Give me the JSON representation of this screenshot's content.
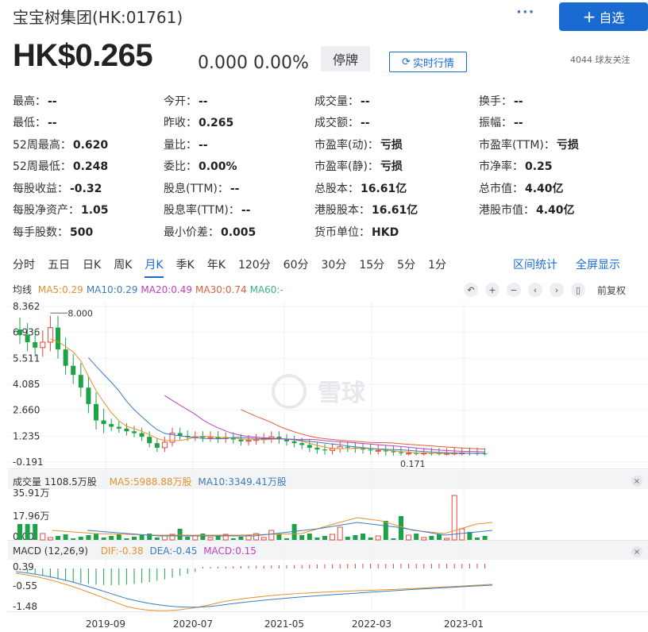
{
  "header": {
    "title": "宝宝树集团(HK:01761)",
    "more_label": "···",
    "add_label": "自选"
  },
  "price": {
    "value": "HK$0.265",
    "change": "0.000 0.00%",
    "status": "停牌",
    "realtime_label": "实时行情",
    "followers": "4044  球友关注"
  },
  "quote": [
    [
      [
        "最高：",
        "--"
      ],
      [
        "今开：",
        "--"
      ],
      [
        "成交量：",
        "--"
      ],
      [
        "换手：",
        "--"
      ]
    ],
    [
      [
        "最低：",
        "--"
      ],
      [
        "昨收：",
        "0.265"
      ],
      [
        "成交额：",
        "--"
      ],
      [
        "振幅：",
        "--"
      ]
    ],
    [
      [
        "52周最高：",
        "0.620"
      ],
      [
        "量比：",
        "--"
      ],
      [
        "市盈率(动)：",
        "亏损"
      ],
      [
        "市盈率(TTM)：",
        "亏损"
      ]
    ],
    [
      [
        "52周最低：",
        "0.248"
      ],
      [
        "委比：",
        "0.00%"
      ],
      [
        "市盈率(静)：",
        "亏损"
      ],
      [
        "市净率：",
        "0.25"
      ]
    ],
    [
      [
        "每股收益：",
        "-0.32"
      ],
      [
        "股息(TTM)：",
        "--"
      ],
      [
        "总股本：",
        "16.61亿"
      ],
      [
        "总市值：",
        "4.40亿"
      ]
    ],
    [
      [
        "每股净资产：",
        "1.05"
      ],
      [
        "股息率(TTM)：",
        "--"
      ],
      [
        "港股股本：",
        "16.61亿"
      ],
      [
        "港股市值：",
        "4.40亿"
      ]
    ],
    [
      [
        "每手股数：",
        "500"
      ],
      [
        "最小价差：",
        "0.005"
      ],
      [
        "货币单位：",
        "HKD"
      ],
      [
        "",
        ""
      ]
    ]
  ],
  "tabs": [
    "分时",
    "五日",
    "日K",
    "周K",
    "月K",
    "季K",
    "年K",
    "120分",
    "60分",
    "30分",
    "15分",
    "5分",
    "1分"
  ],
  "active_tab": "月K",
  "tabs_right": [
    "区间统计",
    "全屏显示"
  ],
  "kline": {
    "label": "均线",
    "ma": [
      {
        "text": "MA5:0.29",
        "color": "#e8902a"
      },
      {
        "text": "MA10:0.29",
        "color": "#3a7bc0"
      },
      {
        "text": "MA20:0.49",
        "color": "#c23fc0"
      },
      {
        "text": "MA30:0.74",
        "color": "#e0603a"
      },
      {
        "text": "MA60:-",
        "color": "#3cb47c"
      }
    ],
    "adjust_label": "前复权",
    "max_label": "8.000",
    "min_label": "0.171",
    "watermark": "雪球"
  },
  "volume": {
    "title": "成交量 1108.5万股",
    "ma5": "MA5:5988.88万股",
    "ma10": "MA10:3349.41万股"
  },
  "macd": {
    "title": "MACD (12,26,9)",
    "dif": "DIF:-0.38",
    "dea": "DEA:-0.45",
    "macd": "MACD:0.15"
  },
  "chart_data": [
    {
      "type": "candlestick",
      "title": "",
      "y_ticks": [
        "8.362",
        "6.936",
        "5.511",
        "4.085",
        "2.660",
        "1.235",
        "-0.191"
      ],
      "ylim": [
        -0.191,
        8.362
      ],
      "x_ticks": [
        "2019-09",
        "2020-07",
        "2021-05",
        "2022-03",
        "2023-01"
      ],
      "annotations": [
        "8.000",
        "0.171"
      ],
      "close": [
        6.8,
        6.4,
        6.1,
        6.4,
        7.2,
        6.0,
        5.1,
        4.6,
        3.9,
        3.0,
        2.1,
        1.9,
        1.75,
        1.65,
        1.5,
        1.4,
        1.2,
        0.85,
        0.6,
        0.9,
        1.4,
        1.25,
        1.2,
        1.2,
        1.15,
        1.2,
        1.1,
        1.15,
        1.05,
        0.95,
        1.0,
        1.05,
        1.1,
        1.2,
        1.05,
        0.95,
        0.85,
        0.75,
        0.6,
        0.5,
        0.45,
        0.55,
        0.65,
        0.6,
        0.55,
        0.5,
        0.45,
        0.45,
        0.4,
        0.35,
        0.3,
        0.3,
        0.28,
        0.3,
        0.29,
        0.27,
        0.28,
        0.3,
        0.31,
        0.3,
        0.28,
        0.265
      ]
    },
    {
      "type": "bar",
      "title": "成交量",
      "y_ticks": [
        "35.91万",
        "17.96万",
        "0.00"
      ],
      "ylim": [
        0,
        35.91
      ]
    },
    {
      "type": "bar",
      "title": "MACD (12,26,9)",
      "y_ticks": [
        "0.39",
        "-0.55",
        "-1.48"
      ],
      "ylim": [
        -1.48,
        0.39
      ]
    }
  ]
}
